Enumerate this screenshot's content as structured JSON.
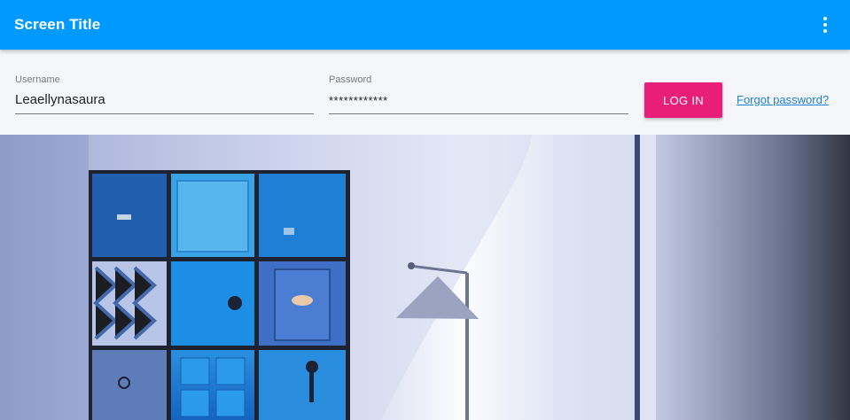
{
  "appbar": {
    "title": "Screen Title",
    "menu_icon": "more-vert-icon"
  },
  "login_form": {
    "username": {
      "label": "Username",
      "value": "Leaellynasaura"
    },
    "password": {
      "label": "Password",
      "value": "************"
    },
    "login_button_label": "LOG IN",
    "forgot_link_label": "Forgot password?"
  },
  "hero_image": {
    "subject": "interior-photo-blue-doors-floor-lamp"
  },
  "colors": {
    "appbar": "#0099ff",
    "accent": "#e91e7a",
    "link": "#1d7fd0",
    "background": "#f5f6fa"
  }
}
